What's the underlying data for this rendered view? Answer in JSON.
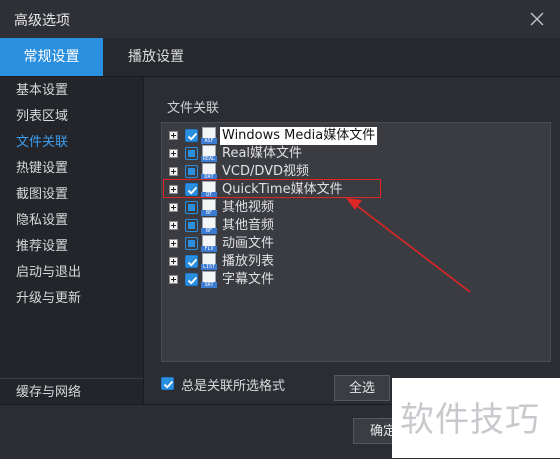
{
  "window": {
    "title": "高级选项"
  },
  "tabs": [
    {
      "label": "常规设置",
      "active": true
    },
    {
      "label": "播放设置",
      "active": false
    }
  ],
  "sidebar": {
    "items": [
      {
        "label": "基本设置",
        "active": false
      },
      {
        "label": "列表区域",
        "active": false
      },
      {
        "label": "文件关联",
        "active": true
      },
      {
        "label": "热键设置",
        "active": false
      },
      {
        "label": "截图设置",
        "active": false
      },
      {
        "label": "隐私设置",
        "active": false
      },
      {
        "label": "推荐设置",
        "active": false
      },
      {
        "label": "启动与退出",
        "active": false
      },
      {
        "label": "升级与更新",
        "active": false
      }
    ],
    "bottom_item": "缓存与网络"
  },
  "file_assoc": {
    "section_label": "文件关联",
    "rows": [
      {
        "label": "Windows Media媒体文件",
        "tag": "ASF",
        "state": "checked",
        "highlight_text": true
      },
      {
        "label": "Real媒体文件",
        "tag": "REAL",
        "state": "partial"
      },
      {
        "label": "VCD/DVD视频",
        "tag": "DAT",
        "state": "partial"
      },
      {
        "label": "QuickTime媒体文件",
        "tag": "QT",
        "state": "checked",
        "boxed": true
      },
      {
        "label": "其他视频",
        "tag": "BF",
        "state": "partial"
      },
      {
        "label": "其他音频",
        "tag": "BF",
        "state": "partial"
      },
      {
        "label": "动画文件",
        "tag": "FLV",
        "state": "partial"
      },
      {
        "label": "播放列表",
        "tag": "LIST",
        "state": "checked"
      },
      {
        "label": "字幕文件",
        "tag": "SRT",
        "state": "checked"
      }
    ]
  },
  "footer": {
    "always_associate_label": "总是关联所选格式",
    "select_all_label": "全选",
    "confirm_label": "确定"
  },
  "watermark": {
    "text": "软件技巧"
  },
  "colors": {
    "accent": "#2b8fe0",
    "annotation": "#e02525"
  }
}
